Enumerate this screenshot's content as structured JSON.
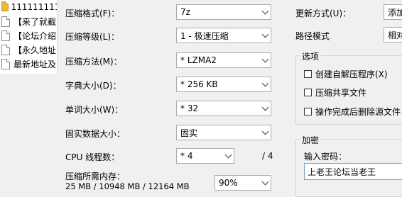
{
  "file_list": [
    {
      "icon": "folder-icon",
      "name": "1111111111"
    },
    {
      "icon": "document-icon",
      "name": "【来了就截"
    },
    {
      "icon": "document-icon",
      "name": "【论坛介绍"
    },
    {
      "icon": "document-icon",
      "name": "【永久地址"
    },
    {
      "icon": "document-icon",
      "name": "最新地址及"
    }
  ],
  "compression": {
    "format_label": "压缩格式(F)：",
    "format_value": "7z",
    "level_label": "压缩等级(L)：",
    "level_value": "1 - 极速压缩",
    "method_label": "压缩方法(M)：",
    "method_value": "* LZMA2",
    "dict_label": "字典大小(D)：",
    "dict_value": "* 256 KB",
    "word_label": "单词大小(W)：",
    "word_value": "* 32",
    "solid_label": "固实数据大小：",
    "solid_value": "固实",
    "threads_label": "CPU 线程数：",
    "threads_value": "* 4",
    "threads_total": "/ 4",
    "memory_label": "压缩所需内存：",
    "memory_value": "25 MB / 10948 MB / 12164 MB",
    "memory_percent": "90%"
  },
  "right_panel": {
    "update_label": "更新方式(U)：",
    "update_value": "添加",
    "path_label": "路径模式",
    "path_value": "相对",
    "options": {
      "title": "选项",
      "items": [
        {
          "label": "创建自解压程序(X)",
          "checked": false
        },
        {
          "label": "压缩共享文件",
          "checked": false
        },
        {
          "label": "操作完成后删除源文件",
          "checked": false
        }
      ]
    },
    "encryption": {
      "title": "加密",
      "password_label": "输入密码：",
      "password_value": "上老王论坛当老王"
    }
  }
}
